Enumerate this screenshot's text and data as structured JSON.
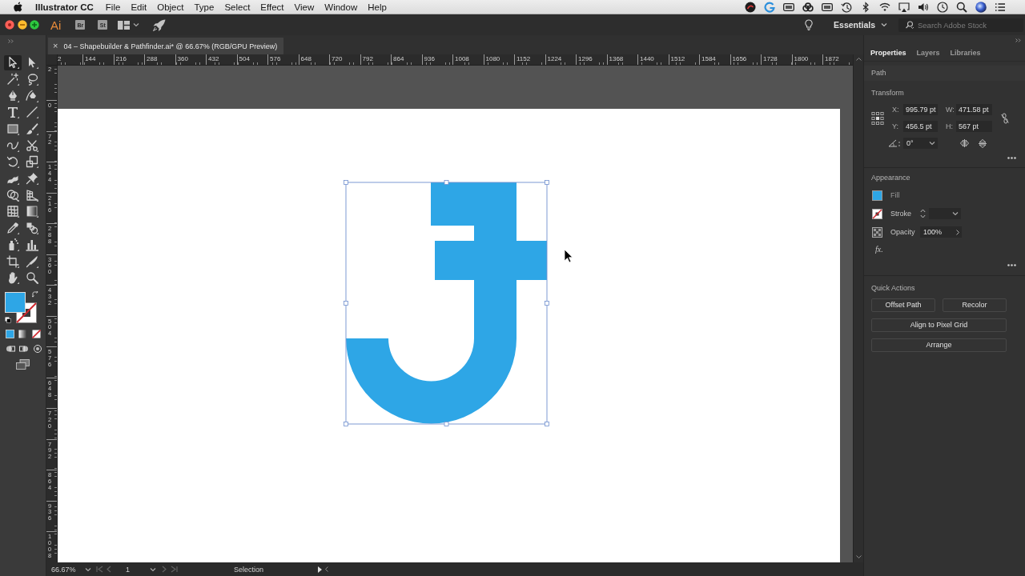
{
  "menu_bar": {
    "app_name": "Illustrator CC",
    "menus": [
      "File",
      "Edit",
      "Object",
      "Type",
      "Select",
      "Effect",
      "View",
      "Window",
      "Help"
    ]
  },
  "app_bar": {
    "logo": "Ai",
    "app_buttons": [
      "Br",
      "St"
    ],
    "workspace": "Essentials",
    "search": {
      "placeholder": "Search Adobe Stock"
    }
  },
  "document_tab": {
    "close": "×",
    "title": "04 – Shapebuilder & Pathfinder.ai* @ 66.67% (RGB/GPU Preview)"
  },
  "toolbar": {
    "tools": [
      {
        "kind": "selection",
        "selected": true
      },
      {
        "kind": "direct_selection",
        "selected": false
      },
      {
        "kind": "magic_wand",
        "selected": false
      },
      {
        "kind": "lasso",
        "selected": false
      },
      {
        "kind": "pen",
        "selected": false
      },
      {
        "kind": "curvature",
        "selected": false
      },
      {
        "kind": "type",
        "selected": false
      },
      {
        "kind": "line",
        "selected": false
      },
      {
        "kind": "rectangle",
        "selected": false
      },
      {
        "kind": "paintbrush",
        "selected": false
      },
      {
        "kind": "shaper",
        "selected": false
      },
      {
        "kind": "scissors",
        "selected": false
      },
      {
        "kind": "rotate",
        "selected": false
      },
      {
        "kind": "scale",
        "selected": false
      },
      {
        "kind": "warp",
        "selected": false
      },
      {
        "kind": "pin",
        "selected": false
      },
      {
        "kind": "shape_builder",
        "selected": false
      },
      {
        "kind": "perspective",
        "selected": false
      },
      {
        "kind": "mesh",
        "selected": false
      },
      {
        "kind": "gradient",
        "selected": false
      },
      {
        "kind": "eyedropper",
        "selected": false
      },
      {
        "kind": "blend",
        "selected": false
      },
      {
        "kind": "sprayer",
        "selected": false
      },
      {
        "kind": "graph",
        "selected": false
      },
      {
        "kind": "artboard",
        "selected": false
      },
      {
        "kind": "slice",
        "selected": false
      },
      {
        "kind": "hand",
        "selected": false
      },
      {
        "kind": "zoom",
        "selected": false
      }
    ]
  },
  "rulers": {
    "horizontal": [
      "2",
      "144",
      "216",
      "288",
      "360",
      "432",
      "504",
      "576",
      "648",
      "720",
      "792",
      "864",
      "936",
      "1008",
      "1080",
      "1152",
      "1224",
      "1296",
      "1368",
      "1440",
      "1512",
      "1584",
      "1656",
      "1728",
      "1800",
      "1872"
    ],
    "vertical": [
      "2",
      "0",
      "72",
      "144",
      "216",
      "288",
      "360",
      "432",
      "504",
      "576",
      "648",
      "720",
      "792",
      "864",
      "936",
      "1008"
    ]
  },
  "artwork": {
    "selected": true
  },
  "properties_panel": {
    "tabs": [
      {
        "label": "Properties",
        "selected": true
      },
      {
        "label": "Layers",
        "selected": false
      },
      {
        "label": "Libraries",
        "selected": false
      }
    ],
    "object_type": "Path",
    "transform": {
      "title": "Transform",
      "fields": [
        {
          "label": "X:",
          "value": "995.79 pt"
        },
        {
          "label": "W:",
          "value": "471.58 pt"
        },
        {
          "label": "Y:",
          "value": "456.5 pt"
        },
        {
          "label": "H:",
          "value": "567 pt"
        }
      ],
      "angle": "0°"
    },
    "appearance": {
      "title": "Appearance",
      "fill": {
        "label": "Fill",
        "color": "#2ea6e6"
      },
      "stroke": {
        "label": "Stroke",
        "none": true
      },
      "opacity": {
        "label": "Opacity",
        "value": "100%"
      },
      "effects": "fx."
    },
    "quick_actions": {
      "title": "Quick Actions",
      "buttons": [
        "Offset Path",
        "Recolor",
        "Align to Pixel Grid",
        "Arrange"
      ]
    }
  },
  "status_bar": {
    "zoom": "66.67%",
    "artboard": "1",
    "navigation": [
      {
        "kind": "first",
        "disabled": true
      },
      {
        "kind": "previous",
        "disabled": true
      },
      {
        "kind": "next",
        "disabled": true
      },
      {
        "kind": "last",
        "disabled": true
      }
    ],
    "tool": "Selection"
  }
}
